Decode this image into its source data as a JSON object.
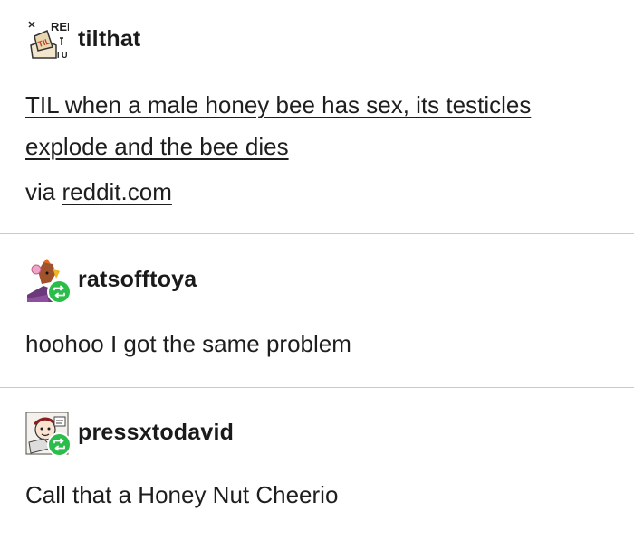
{
  "posts": [
    {
      "username": "tilthat",
      "avatar_icon": "til-logo-icon",
      "avatar_text": "REI",
      "title": "TIL when a male honey bee has sex, its testicles explode and the bee dies",
      "via_prefix": "via",
      "via_link": "reddit.com"
    },
    {
      "username": "ratsofftoya",
      "avatar_icon": "rat-avatar-icon",
      "reblog_icon": "reblog-icon",
      "text": "hoohoo I got the same problem"
    },
    {
      "username": "pressxtodavid",
      "avatar_icon": "comic-avatar-icon",
      "reblog_icon": "reblog-icon",
      "text": "Call that a Honey Nut Cheerio"
    }
  ],
  "colors": {
    "reblog_green": "#2bbd4a",
    "divider": "#c9c9c9",
    "text": "#1e1e1e"
  }
}
